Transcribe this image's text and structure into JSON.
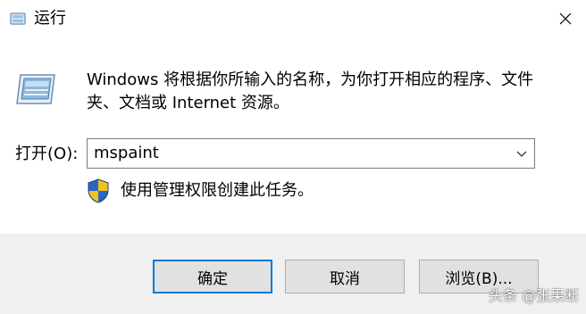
{
  "window": {
    "title": "运行",
    "title_icon": "run-icon",
    "close_icon": "close-icon"
  },
  "content": {
    "description": "Windows 将根据你所输入的名称，为你打开相应的程序、文件夹、文档或 Internet 资源。",
    "open_label": "打开(O):",
    "open_input_value": "mspaint",
    "admin_note": "使用管理权限创建此任务。",
    "shield_icon": "uac-shield-icon"
  },
  "buttons": {
    "ok": "确定",
    "cancel": "取消",
    "browse": "浏览(B)..."
  },
  "watermark": "头条 @张果断",
  "colors": {
    "accent": "#0078d7",
    "footer_bg": "#f0f0f0",
    "button_bg": "#e1e1e1"
  }
}
